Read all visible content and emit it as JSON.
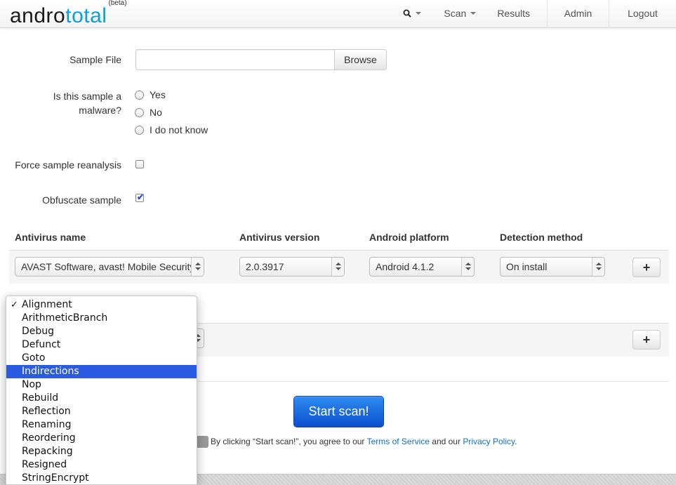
{
  "navbar": {
    "brand_prefix": "andro",
    "brand_suffix": "total",
    "brand_tag": "(beta)",
    "items": [
      {
        "label": "",
        "icon": "search-icon"
      },
      {
        "label": "Scan"
      },
      {
        "label": "Results"
      },
      {
        "label": "Admin"
      },
      {
        "label": "Logout"
      }
    ]
  },
  "form": {
    "sample_file_label": "Sample File",
    "sample_file_value": "",
    "browse_label": "Browse",
    "malware_question_line1": "Is this sample a",
    "malware_question_line2": "malware?",
    "malware_options": [
      "Yes",
      "No",
      "I do not know"
    ],
    "force_reanalysis_label": "Force sample reanalysis",
    "force_reanalysis_checked": false,
    "obfuscate_label": "Obfuscate sample",
    "obfuscate_checked": true
  },
  "antivirus_table": {
    "headers": [
      "Antivirus name",
      "Antivirus version",
      "Android platform",
      "Detection method"
    ],
    "row": {
      "name": "AVAST Software, avast! Mobile Security",
      "version": "2.0.3917",
      "platform": "Android 4.1.2",
      "detection": "On install"
    },
    "add_label": "+"
  },
  "obfuscation": {
    "add_label": "+",
    "dropdown_options": [
      "Alignment",
      "ArithmeticBranch",
      "Debug",
      "Defunct",
      "Goto",
      "Indirections",
      "Nop",
      "Rebuild",
      "Reflection",
      "Renaming",
      "Reordering",
      "Repacking",
      "Resigned",
      "StringEncrypt"
    ],
    "checked_option": "Alignment",
    "highlighted_option": "Indirections"
  },
  "submit": {
    "start_label": "Start scan!",
    "terms_prefix": "By clicking “Start scan!”, you agree to our",
    "terms_link": "Terms of Service",
    "terms_middle": "and our",
    "privacy_link": "Privacy Policy",
    "terms_suffix": "."
  },
  "colors": {
    "brand_accent": "#0aa0d8",
    "primary_button": "#1a6de8",
    "dropdown_highlight": "#2b5be0",
    "link": "#0d6fc9"
  }
}
